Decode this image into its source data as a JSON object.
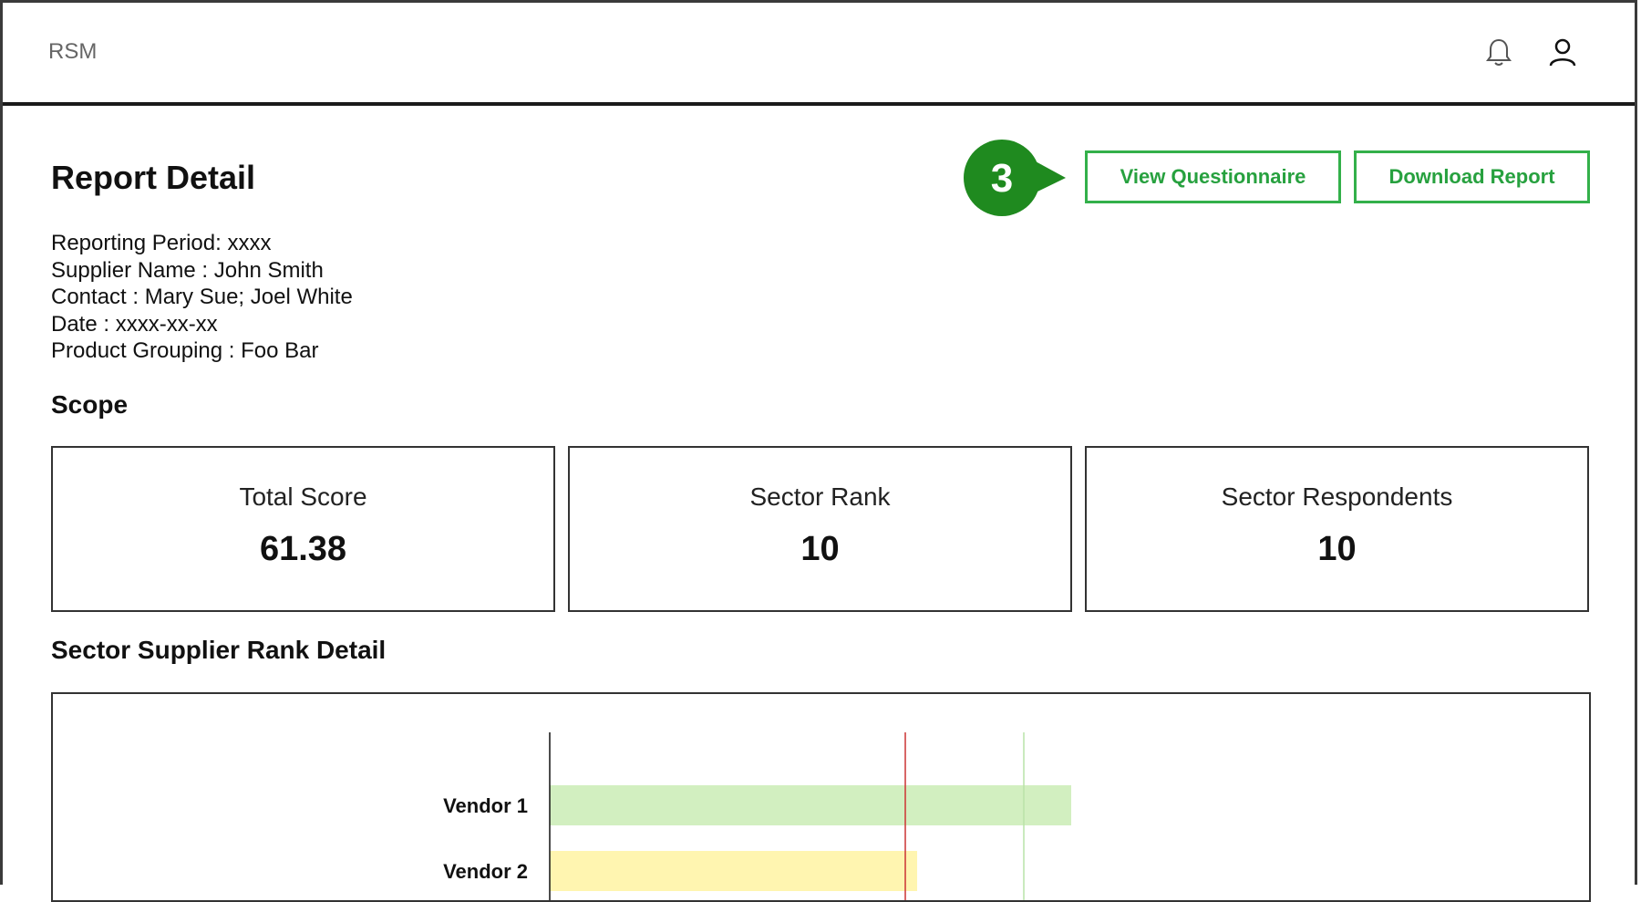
{
  "app": {
    "title": "RSM"
  },
  "header_icons": {
    "bell": "bell-icon",
    "user": "user-icon"
  },
  "page": {
    "title": "Report Detail"
  },
  "callout": {
    "number": "3",
    "color": "#1f8a1f"
  },
  "actions": {
    "view_questionnaire": "View Questionnaire",
    "download_report": "Download Report",
    "accent_color": "#33b04a"
  },
  "meta": [
    "Reporting Period: xxxx",
    "Supplier Name : John Smith",
    "Contact : Mary Sue; Joel White",
    "Date : xxxx-xx-xx",
    "Product Grouping : Foo Bar"
  ],
  "scope": {
    "title": "Scope",
    "cards": [
      {
        "label": "Total Score",
        "value": "61.38"
      },
      {
        "label": "Sector Rank",
        "value": "10"
      },
      {
        "label": "Sector Respondents",
        "value": "10"
      }
    ]
  },
  "rank_detail": {
    "title": "Sector Supplier Rank Detail"
  },
  "chart_data": {
    "type": "bar",
    "orientation": "horizontal",
    "categories": [
      "Vendor 1",
      "Vendor 2"
    ],
    "values": [
      44,
      31
    ],
    "colors": [
      "#d2efc0",
      "#fff5b0"
    ],
    "xlim": [
      0,
      100
    ],
    "reference_lines": [
      {
        "value": 30,
        "color": "#cc3333"
      },
      {
        "value": 40,
        "color": "#b9e3a8"
      }
    ]
  }
}
